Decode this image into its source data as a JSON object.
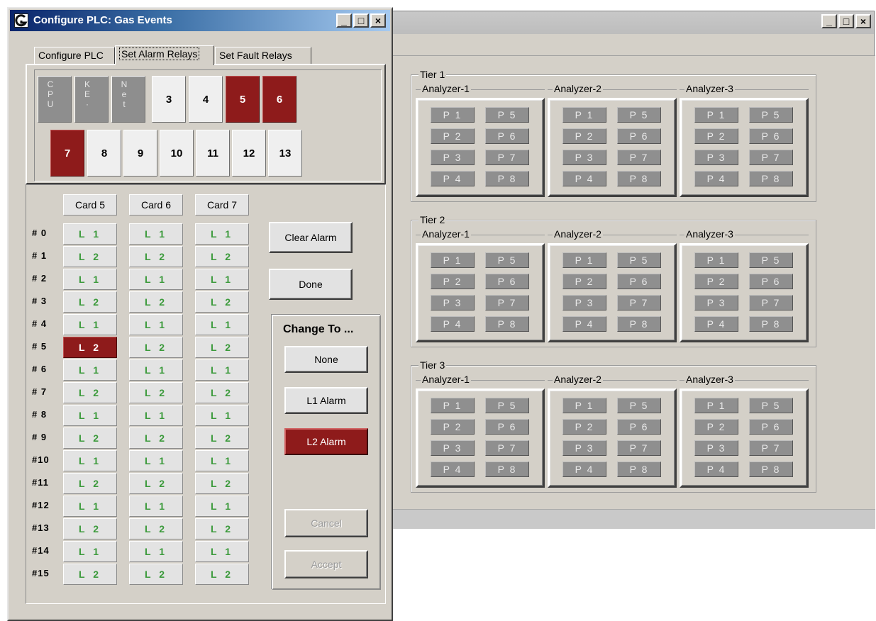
{
  "front_window": {
    "title": "Configure PLC:  Gas Events",
    "controls": {
      "minimize": "_",
      "maximize": "□",
      "close": "×"
    },
    "tabs": [
      {
        "label": "Configure PLC",
        "active": false
      },
      {
        "label": "Set Alarm Relays",
        "active": true
      },
      {
        "label": "Set Fault Relays",
        "active": false
      }
    ],
    "slots_row1": [
      {
        "label": "CPU",
        "style": "gray"
      },
      {
        "label": "KE·",
        "style": "gray"
      },
      {
        "label": "Net",
        "style": "gray"
      },
      {
        "label": "3",
        "style": "white"
      },
      {
        "label": "4",
        "style": "white"
      },
      {
        "label": "5",
        "style": "red"
      },
      {
        "label": "6",
        "style": "red"
      }
    ],
    "slots_row2": [
      {
        "label": "7",
        "style": "red"
      },
      {
        "label": "8",
        "style": "white"
      },
      {
        "label": "9",
        "style": "white"
      },
      {
        "label": "10",
        "style": "white"
      },
      {
        "label": "11",
        "style": "white"
      },
      {
        "label": "12",
        "style": "white"
      },
      {
        "label": "13",
        "style": "white"
      }
    ],
    "cards": [
      "Card 5",
      "Card 6",
      "Card 7"
    ],
    "rows": [
      {
        "label": "# 0",
        "relay": "L 1"
      },
      {
        "label": "# 1",
        "relay": "L 2"
      },
      {
        "label": "# 2",
        "relay": "L 1"
      },
      {
        "label": "# 3",
        "relay": "L 2"
      },
      {
        "label": "# 4",
        "relay": "L 1"
      },
      {
        "label": "# 5",
        "relay": "L 2"
      },
      {
        "label": "# 6",
        "relay": "L 1"
      },
      {
        "label": "# 7",
        "relay": "L 2"
      },
      {
        "label": "# 8",
        "relay": "L 1"
      },
      {
        "label": "# 9",
        "relay": "L 2"
      },
      {
        "label": "#10",
        "relay": "L 1"
      },
      {
        "label": "#11",
        "relay": "L 2"
      },
      {
        "label": "#12",
        "relay": "L 1"
      },
      {
        "label": "#13",
        "relay": "L 2"
      },
      {
        "label": "#14",
        "relay": "L 1"
      },
      {
        "label": "#15",
        "relay": "L 2"
      }
    ],
    "selected_relay": {
      "card": "Card 5",
      "row": "# 5"
    },
    "buttons": {
      "clear_alarm": "Clear Alarm",
      "done": "Done",
      "cancel": "Cancel",
      "accept": "Accept"
    },
    "change_to": {
      "title": "Change To ...",
      "options": [
        {
          "label": "None",
          "selected": false
        },
        {
          "label": "L1 Alarm",
          "selected": false
        },
        {
          "label": "L2 Alarm",
          "selected": true
        }
      ]
    }
  },
  "back_window": {
    "controls": {
      "minimize": "_",
      "maximize": "□",
      "close": "×"
    },
    "tiers": [
      {
        "label": "Tier 1",
        "analyzers": [
          "Analyzer-1",
          "Analyzer-2",
          "Analyzer-3"
        ]
      },
      {
        "label": "Tier 2",
        "analyzers": [
          "Analyzer-1",
          "Analyzer-2",
          "Analyzer-3"
        ]
      },
      {
        "label": "Tier 3",
        "analyzers": [
          "Analyzer-1",
          "Analyzer-2",
          "Analyzer-3"
        ]
      }
    ],
    "points": [
      "P 1",
      "P 5",
      "P 2",
      "P 6",
      "P 3",
      "P 7",
      "P 4",
      "P 8"
    ]
  },
  "colors": {
    "alarm_red": "#8e1b1b",
    "relay_green": "#3b9a3b",
    "titlebar_blue": "#0a246a",
    "window_face": "#d4d0c8"
  }
}
